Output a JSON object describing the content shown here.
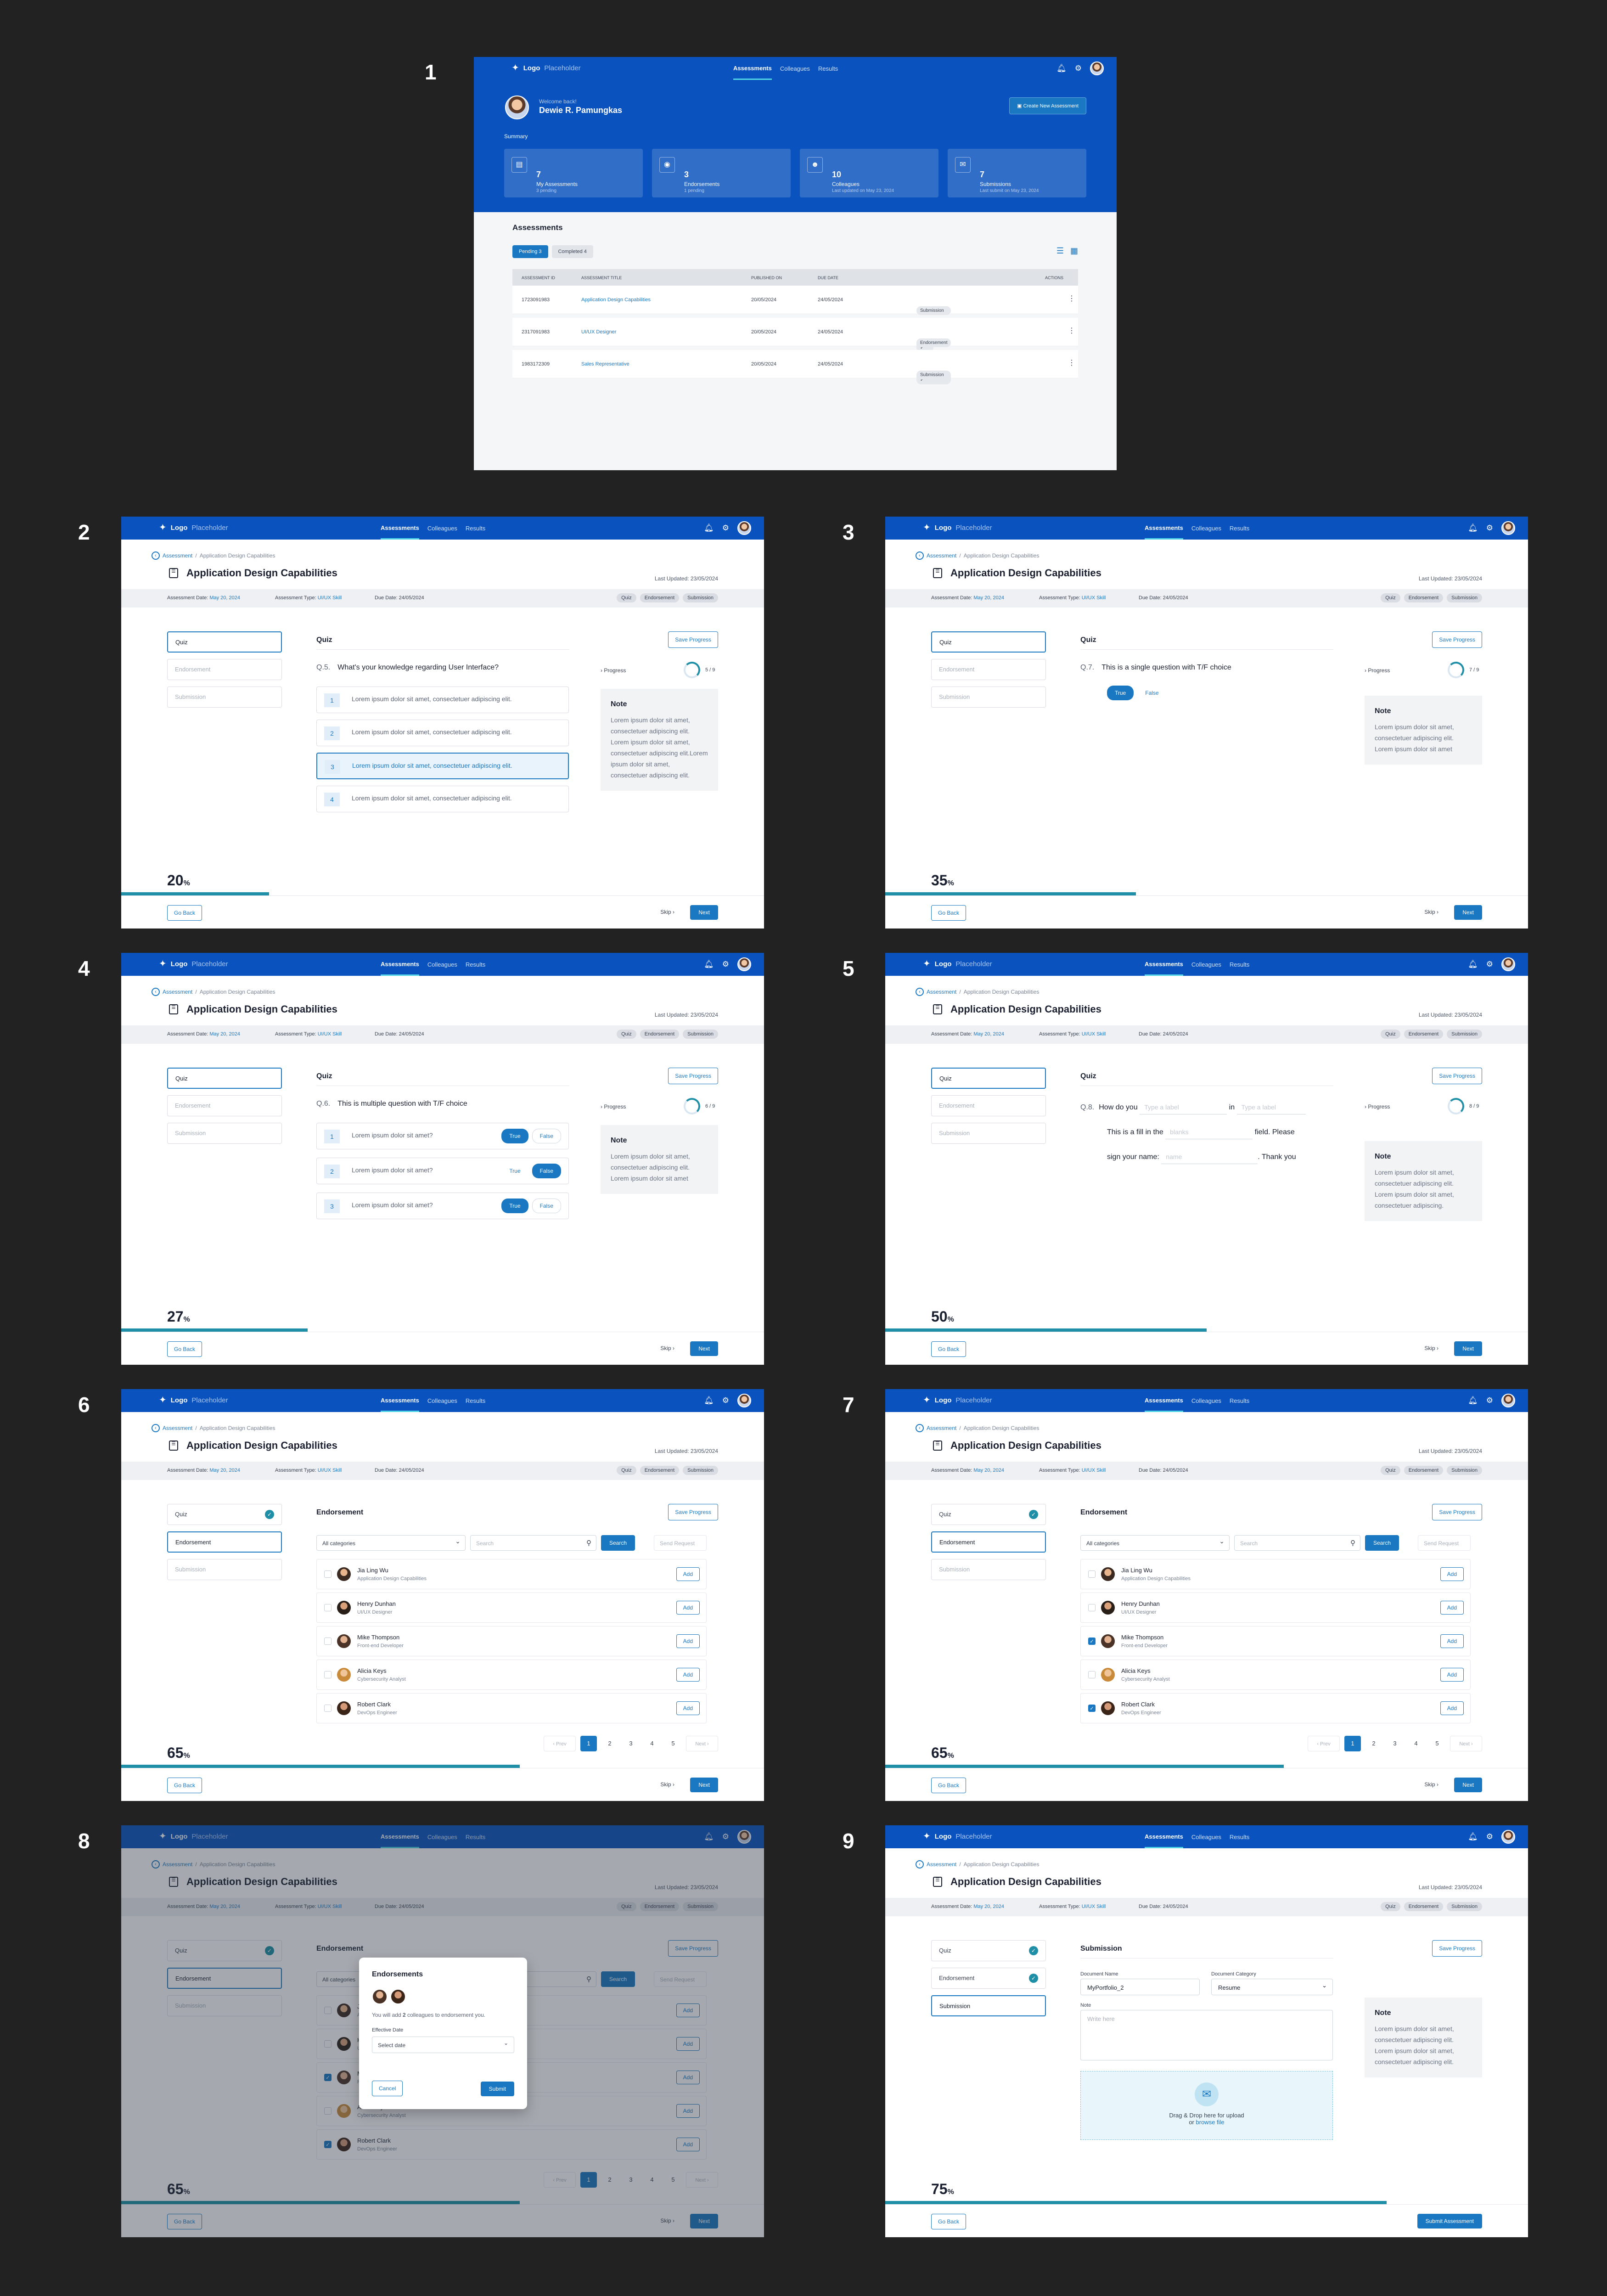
{
  "screen_numbers": [
    "1",
    "2",
    "3",
    "4",
    "5",
    "6",
    "7",
    "8",
    "9"
  ],
  "brand": {
    "logo_bold": "Logo",
    "logo_light": "Placeholder"
  },
  "nav": {
    "assessments": "Assessments",
    "colleagues": "Colleagues",
    "results": "Results"
  },
  "dashboard": {
    "welcome": "Welcome back!",
    "user": "Dewie R. Pamungkas",
    "create_button": "Create New Assessment",
    "summary_label": "Summary",
    "cards": [
      {
        "value": "7",
        "label": "My Assessments",
        "sub": "3 pending"
      },
      {
        "value": "3",
        "label": "Endorsements",
        "sub": "1 pending"
      },
      {
        "value": "10",
        "label": "Colleagues",
        "sub": "Last updated on May 23, 2024"
      },
      {
        "value": "7",
        "label": "Submissions",
        "sub": "Last submit on May 23, 2024"
      }
    ],
    "assessments_heading": "Assessments",
    "tabs": {
      "pending": "Pending 3",
      "completed": "Completed 4"
    },
    "columns": [
      "ASSESSMENT ID",
      "ASSESSMENT TITLE",
      "PUBLISHED ON",
      "DUE DATE",
      "ACTIONS"
    ],
    "rows": [
      {
        "id": "1723091983",
        "title": "Application Design Capabilities",
        "published": "20/05/2024",
        "due": "24/05/2024",
        "tags": [
          "Quiz",
          "Endorsement",
          "Submission"
        ]
      },
      {
        "id": "2317091983",
        "title": "UI/UX Designer",
        "published": "20/05/2024",
        "due": "24/05/2024",
        "tags": [
          "Quiz ✓",
          "Endorsement"
        ]
      },
      {
        "id": "1983172309",
        "title": "Sales Representative",
        "published": "20/05/2024",
        "due": "24/05/2024",
        "tags": [
          "Quiz ✓",
          "Endorsement ✓",
          "Submission"
        ]
      }
    ]
  },
  "common": {
    "crumb_root": "Assessment",
    "crumb_current": "Application Design Capabilities",
    "title": "Application Design Capabilities",
    "last_updated": "Last Updated: 23/05/2024",
    "meta_date_label": "Assessment Date:",
    "meta_date": "May 20, 2024",
    "meta_type_label": "Assessment Type:",
    "meta_type": "UI/UX Skill",
    "meta_due": "Due Date: 24/05/2024",
    "badges": [
      "Quiz",
      "Endorsement",
      "Submission"
    ],
    "side": [
      "Quiz",
      "Endorsement",
      "Submission"
    ],
    "save_progress": "Save Progress",
    "go_back": "Go Back",
    "skip": "Skip ›",
    "next": "Next",
    "progress_label": "› Progress",
    "note_title": "Note"
  },
  "screens": {
    "s2": {
      "section": "Quiz",
      "qnum": "Q.5.",
      "question": "What's your knowledge regarding User Interface?",
      "ring": "5 / 9",
      "pct": "20",
      "bar": 0.23,
      "options": [
        "Lorem ipsum dolor sit amet, consectetuer adipiscing elit.",
        "Lorem ipsum dolor sit amet, consectetuer adipiscing elit.",
        "Lorem ipsum dolor sit amet, consectetuer adipiscing elit.",
        "Lorem ipsum dolor sit amet, consectetuer adipiscing elit."
      ],
      "note": "Lorem ipsum dolor sit amet, consectetuer adipiscing elit. Lorem ipsum dolor sit amet, consectetuer adipiscing elit.Lorem ipsum dolor sit amet, consectetuer adipiscing elit."
    },
    "s3": {
      "section": "Quiz",
      "qnum": "Q.7.",
      "question": "This is a single question with T/F choice",
      "ring": "7 / 9",
      "pct": "35",
      "bar": 0.39,
      "true_label": "True",
      "false_label": "False",
      "note": "Lorem ipsum dolor sit amet, consectetuer adipiscing elit. Lorem ipsum dolor sit amet"
    },
    "s4": {
      "section": "Quiz",
      "qnum": "Q.6.",
      "question": "This is multiple question with T/F choice",
      "ring": "6 / 9",
      "pct": "27",
      "bar": 0.29,
      "items": [
        "Lorem ipsum dolor sit amet?",
        "Lorem ipsum dolor sit amet?",
        "Lorem ipsum dolor sit amet?"
      ],
      "true_label": "True",
      "false_label": "False",
      "note": "Lorem ipsum dolor sit amet, consectetuer adipiscing elit. Lorem ipsum dolor sit amet"
    },
    "s5": {
      "section": "Quiz",
      "qnum": "Q.8.",
      "ring": "8 / 9",
      "pct": "50",
      "bar": 0.5,
      "t1": "How do you",
      "p1": "Type a label",
      "t2": "in",
      "p2": "Type a label",
      "t3": "This is a fill in the",
      "p3": "blanks",
      "t4": "field. Please",
      "t5": "sign your name:",
      "p4": "name",
      "t6": ". Thank you",
      "note": "Lorem ipsum dolor sit amet, consectetuer adipiscing elit. Lorem ipsum dolor sit amet, consectetuer adipiscing."
    },
    "s6": {
      "section": "Endorsement",
      "pct": "65",
      "bar": 0.62
    },
    "s9": {
      "section": "Submission",
      "pct": "75",
      "bar": 0.78,
      "doc_name_label": "Document Name",
      "doc_name": "MyPortfolio_2",
      "doc_cat_label": "Document Category",
      "doc_cat": "Resume",
      "note_label": "Note",
      "note_placeholder": "Write here",
      "drop_text": "Drag & Drop here for upload",
      "drop_or": "or",
      "drop_link": "browse file",
      "submit": "Submit Assessment",
      "note": "Lorem ipsum dolor sit amet, consectetuer adipiscing elit. Lorem ipsum dolor sit amet, consectetuer adipiscing elit."
    }
  },
  "endorse": {
    "category": "All categories",
    "search_placeholder": "Search",
    "search_button": "Search",
    "send_request": "Send Request",
    "add": "Add",
    "people": [
      {
        "name": "Jia Ling Wu",
        "role": "Application Design Capabilities"
      },
      {
        "name": "Henry Dunhan",
        "role": "UI/UX Designer"
      },
      {
        "name": "Mike Thompson",
        "role": "Front-end Developer"
      },
      {
        "name": "Alicia Keys",
        "role": "Cybersecurity Analyst"
      },
      {
        "name": "Robert Clark",
        "role": "DevOps Engineer"
      }
    ],
    "pager": {
      "prev": "‹ Prev",
      "next": "Next ›",
      "pages": [
        "1",
        "2",
        "3",
        "4",
        "5"
      ]
    }
  },
  "modal": {
    "title": "Endorsements",
    "desc_a": "You will add",
    "desc_n": "2",
    "desc_b": "colleagues to endorsement you.",
    "date_label": "Effective Date",
    "date_placeholder": "Select date",
    "cancel": "Cancel",
    "submit": "Submit"
  },
  "colors": {
    "nav": "#0a53be",
    "accent": "#1a78c2",
    "progress": "#1e8fa6"
  }
}
